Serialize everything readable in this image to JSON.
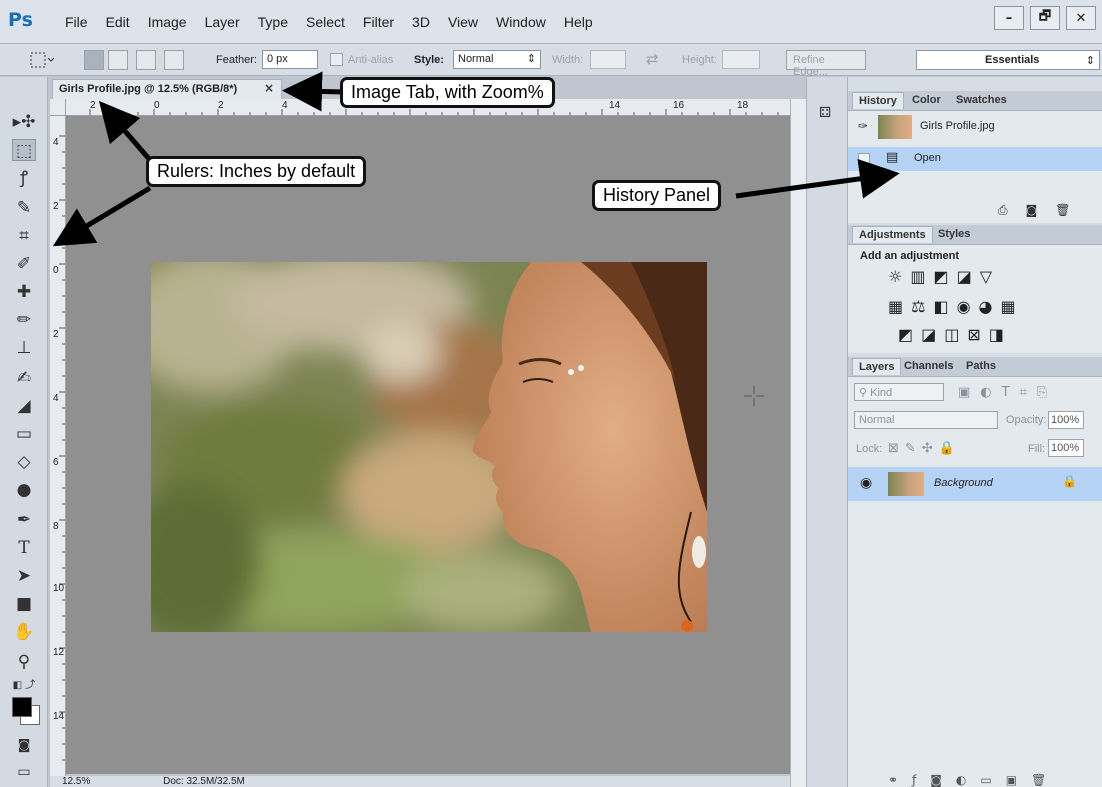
{
  "app": {
    "logo": "Ps"
  },
  "menu": [
    "File",
    "Edit",
    "Image",
    "Layer",
    "Type",
    "Select",
    "Filter",
    "3D",
    "View",
    "Window",
    "Help"
  ],
  "window_controls": [
    "–",
    "🗗",
    "✕"
  ],
  "options": {
    "feather_label": "Feather:",
    "feather_value": "0 px",
    "antialias_label": "Anti-alias",
    "style_label": "Style:",
    "style_value": "Normal",
    "width_label": "Width:",
    "height_label": "Height:",
    "refine_edge": "Refine Edge...",
    "workspace": "Essentials"
  },
  "document": {
    "tab_title": "Girls Profile.jpg @ 12.5% (RGB/8*)",
    "close": "×",
    "zoom_status": "12.5%",
    "doc_status": "Doc: 32.5M/32.5M"
  },
  "rulers": {
    "top_ticks": [
      "2",
      "0",
      "2",
      "4",
      "14",
      "16",
      "18"
    ],
    "left_ticks": [
      "4",
      "2",
      "0",
      "2",
      "4",
      "6",
      "8",
      "10",
      "12",
      "14"
    ]
  },
  "history": {
    "tabs": [
      "History",
      "Color",
      "Swatches"
    ],
    "snapshot": "Girls Profile.jpg",
    "steps": [
      "Open"
    ]
  },
  "adjustments": {
    "tabs": [
      "Adjustments",
      "Styles"
    ],
    "heading": "Add an adjustment"
  },
  "layers": {
    "tabs": [
      "Layers",
      "Channels",
      "Paths"
    ],
    "filter_kind": "Kind",
    "blend_mode": "Normal",
    "opacity_label": "Opacity:",
    "opacity_value": "100%",
    "lock_label": "Lock:",
    "fill_label": "Fill:",
    "fill_value": "100%",
    "items": [
      {
        "name": "Background"
      }
    ]
  },
  "annotations": {
    "image_tab": "Image Tab, with Zoom%",
    "rulers": "Rulers: Inches by default",
    "history": "History Panel"
  },
  "colors": {
    "accent": "#1c6fb6",
    "selection": "#b5d3f5"
  }
}
